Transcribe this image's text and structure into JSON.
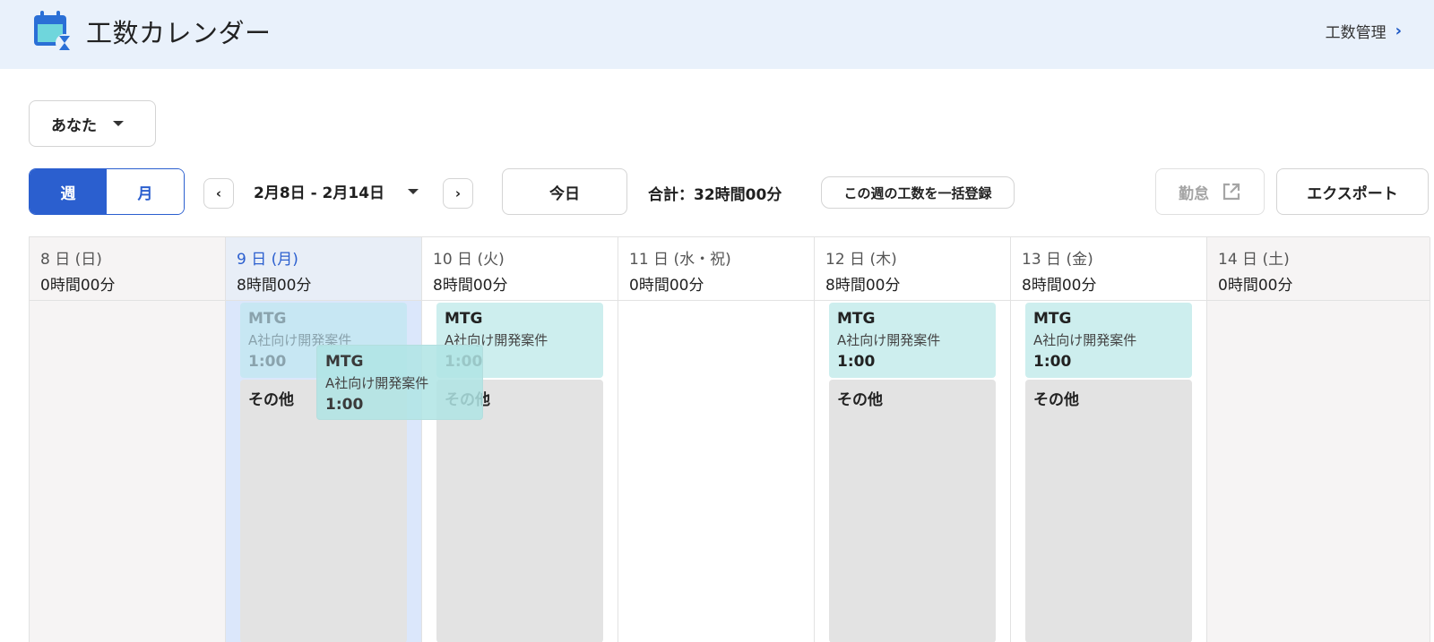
{
  "header": {
    "title": "工数カレンダー",
    "nav_link": "工数管理",
    "logo_icon": "calendar-hourglass-icon"
  },
  "toolbar": {
    "user_select": "あなた",
    "view_week": "週",
    "view_month": "月",
    "prev": "‹",
    "next": "›",
    "date_range": "2月8日 - 2月14日",
    "today": "今日",
    "total": "合計：32時間00分",
    "bulk_register": "この週の工数を一括登録",
    "kintai": "勤怠",
    "export": "エクスポート"
  },
  "colors": {
    "accent": "#2b5fcf",
    "mtg_card": "#cdeeee",
    "other_card": "#e3e3e3"
  },
  "days": [
    {
      "label": "8 日 (日)",
      "hours": "0時間00分"
    },
    {
      "label": "9 日 (月)",
      "hours": "8時間00分"
    },
    {
      "label": "10 日 (火)",
      "hours": "8時間00分"
    },
    {
      "label": "11 日 (水・祝)",
      "hours": "0時間00分"
    },
    {
      "label": "12 日 (木)",
      "hours": "8時間00分"
    },
    {
      "label": "13 日 (金)",
      "hours": "8時間00分"
    },
    {
      "label": "14 日 (土)",
      "hours": "0時間00分"
    }
  ],
  "entries": {
    "mtg": {
      "title": "MTG",
      "project": "A社向け開発案件",
      "duration": "1:00"
    },
    "other": {
      "title": "その他"
    }
  }
}
